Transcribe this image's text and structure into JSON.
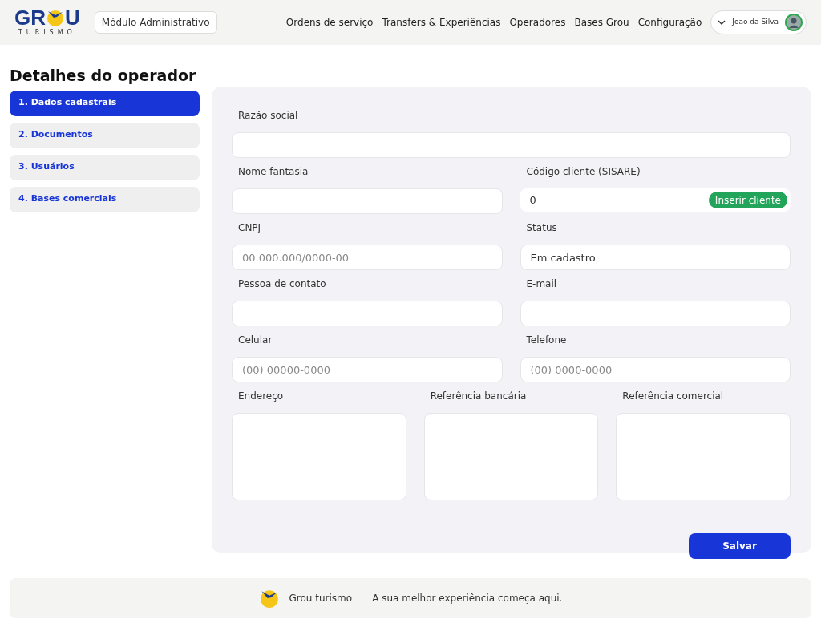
{
  "header": {
    "logo": {
      "left": "GR",
      "right": "U",
      "sub": "TURISMO"
    },
    "module": "Módulo Administrativo",
    "nav": [
      "Ordens de serviço",
      "Transfers & Experiências",
      "Operadores",
      "Bases Grou",
      "Configuração"
    ],
    "user": "Joao da Silva"
  },
  "title": "Detalhes do operador",
  "steps": [
    {
      "label": "1. Dados cadastrais",
      "selected": true
    },
    {
      "label": "2. Documentos",
      "selected": false
    },
    {
      "label": "3. Usuários",
      "selected": false
    },
    {
      "label": "4. Bases comerciais",
      "selected": false
    }
  ],
  "form": {
    "rows": [
      [
        {
          "kind": "text",
          "label": "Razão social"
        }
      ],
      [
        {
          "kind": "text",
          "label": "Nome fantasia"
        },
        {
          "kind": "action",
          "label": "Código cliente (SISARE)",
          "value": "0",
          "action": "Inserir cliente"
        }
      ],
      [
        {
          "kind": "text",
          "label": "CNPJ",
          "placeholder": "00.000.000/0000-00"
        },
        {
          "kind": "text",
          "label": "Status",
          "value": "Em cadastro"
        }
      ],
      [
        {
          "kind": "text",
          "label": "Pessoa de contato"
        },
        {
          "kind": "text",
          "label": "E-mail"
        }
      ],
      [
        {
          "kind": "text",
          "label": "Celular",
          "placeholder": "(00) 00000-0000"
        },
        {
          "kind": "text",
          "label": "Telefone",
          "placeholder": "(00) 0000-0000"
        }
      ],
      [
        {
          "kind": "textarea",
          "label": "Endereço"
        },
        {
          "kind": "textarea",
          "label": "Referência bancária"
        },
        {
          "kind": "textarea",
          "label": "Referência comercial"
        }
      ]
    ],
    "save": "Salvar"
  },
  "footer": {
    "brand": "Grou turismo",
    "tagline": "A sua melhor experiência começa aqui."
  }
}
